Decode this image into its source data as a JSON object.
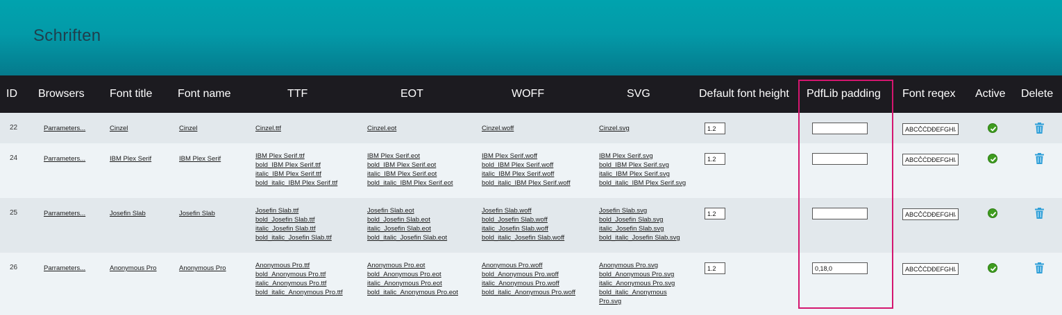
{
  "page": {
    "title": "Schriften"
  },
  "columns": [
    "ID",
    "Browsers",
    "Font title",
    "Font name",
    "TTF",
    "EOT",
    "WOFF",
    "SVG",
    "Default font height",
    "PdfLib padding",
    "Font reqex",
    "Active",
    "Delete"
  ],
  "rows": [
    {
      "id": "22",
      "browsers": "Parrameters...",
      "title": "Cinzel",
      "name": "Cinzel",
      "ttf": [
        "Cinzel.ttf"
      ],
      "eot": [
        "Cinzel.eot"
      ],
      "woff": [
        "Cinzel.woff"
      ],
      "svg": [
        "Cinzel.svg"
      ],
      "height": "1.2",
      "padding": "",
      "regex": "ABCČĆDĐEFGHIJK",
      "active_icon": "check-circle-icon",
      "delete_icon": "trash-icon"
    },
    {
      "id": "24",
      "browsers": "Parrameters...",
      "title": "IBM Plex Serif",
      "name": "IBM Plex Serif",
      "ttf": [
        "IBM Plex Serif.ttf",
        "bold_IBM Plex Serif.ttf",
        "italic_IBM Plex Serif.ttf",
        "bold_italic_IBM Plex Serif.ttf"
      ],
      "eot": [
        "IBM Plex Serif.eot",
        "bold_IBM Plex Serif.eot",
        "italic_IBM Plex Serif.eot",
        "bold_italic_IBM Plex Serif.eot"
      ],
      "woff": [
        "IBM Plex Serif.woff",
        "bold_IBM Plex Serif.woff",
        "italic_IBM Plex Serif.woff",
        "bold_italic_IBM Plex Serif.woff"
      ],
      "svg": [
        "IBM Plex Serif.svg",
        "bold_IBM Plex Serif.svg",
        "italic_IBM Plex Serif.svg",
        "bold_italic_IBM Plex Serif.svg"
      ],
      "height": "1.2",
      "padding": "",
      "regex": "ABCČĆDĐEFGHIJK",
      "active_icon": "check-circle-icon",
      "delete_icon": "trash-icon"
    },
    {
      "id": "25",
      "browsers": "Parrameters...",
      "title": "Josefin Slab",
      "name": "Josefin Slab",
      "ttf": [
        "Josefin Slab.ttf",
        "bold_Josefin Slab.ttf",
        "italic_Josefin Slab.ttf",
        "bold_italic_Josefin Slab.ttf"
      ],
      "eot": [
        "Josefin Slab.eot",
        "bold_Josefin Slab.eot",
        "italic_Josefin Slab.eot",
        "bold_italic_Josefin Slab.eot"
      ],
      "woff": [
        "Josefin Slab.woff",
        "bold_Josefin Slab.woff",
        "italic_Josefin Slab.woff",
        "bold_italic_Josefin Slab.woff"
      ],
      "svg": [
        "Josefin Slab.svg",
        "bold_Josefin Slab.svg",
        "italic_Josefin Slab.svg",
        "bold_italic_Josefin Slab.svg"
      ],
      "height": "1.2",
      "padding": "",
      "regex": "ABCČĆDĐEFGHIJK",
      "active_icon": "check-circle-icon",
      "delete_icon": "trash-icon"
    },
    {
      "id": "26",
      "browsers": "Parrameters...",
      "title": "Anonymous Pro",
      "name": "Anonymous Pro",
      "ttf": [
        "Anonymous Pro.ttf",
        "bold_Anonymous Pro.ttf",
        "italic_Anonymous Pro.ttf",
        "bold_italic_Anonymous Pro.ttf"
      ],
      "eot": [
        "Anonymous Pro.eot",
        "bold_Anonymous Pro.eot",
        "italic_Anonymous Pro.eot",
        "bold_italic_Anonymous Pro.eot"
      ],
      "woff": [
        "Anonymous Pro.woff",
        "bold_Anonymous Pro.woff",
        "italic_Anonymous Pro.woff",
        "bold_italic_Anonymous Pro.woff"
      ],
      "svg": [
        "Anonymous Pro.svg",
        "bold_Anonymous Pro.svg",
        "italic_Anonymous Pro.svg",
        "bold_italic_Anonymous",
        "Pro.svg"
      ],
      "height": "1.2",
      "padding": "0,18,0",
      "regex": "ABCČĆDĐEFGHIJK",
      "active_icon": "check-circle-icon",
      "delete_icon": "trash-icon"
    }
  ],
  "colors": {
    "header_top": "#00a3ae",
    "header_bottom": "#057a8c",
    "table_head": "#1c1b20",
    "highlight": "#d4166f",
    "active": "#3e9c1f",
    "delete": "#2f9fd8"
  }
}
